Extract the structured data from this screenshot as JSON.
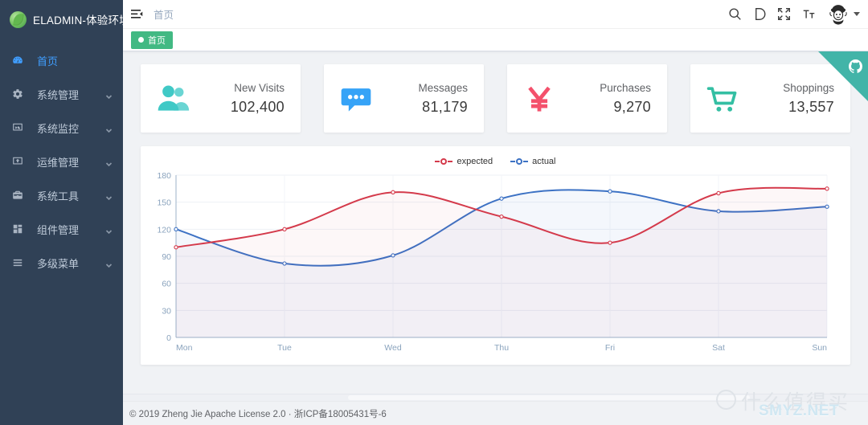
{
  "app": {
    "brand": "ELADMIN-体验环境",
    "logo_icon": "leaf-logo-icon"
  },
  "sidebar": {
    "items": [
      {
        "label": "首页",
        "icon": "dashboard-icon",
        "active": true,
        "expandable": false
      },
      {
        "label": "系统管理",
        "icon": "gear-icon",
        "active": false,
        "expandable": true
      },
      {
        "label": "系统监控",
        "icon": "monitor-icon",
        "active": false,
        "expandable": true
      },
      {
        "label": "运维管理",
        "icon": "deploy-icon",
        "active": false,
        "expandable": true
      },
      {
        "label": "系统工具",
        "icon": "toolbox-icon",
        "active": false,
        "expandable": true
      },
      {
        "label": "组件管理",
        "icon": "components-icon",
        "active": false,
        "expandable": true
      },
      {
        "label": "多级菜单",
        "icon": "menu-list-icon",
        "active": false,
        "expandable": true
      }
    ]
  },
  "navbar": {
    "hamburger_icon": "hamburger-icon",
    "breadcrumb": "首页",
    "icons": [
      {
        "name": "search-icon",
        "glyph": "search"
      },
      {
        "name": "documentation-icon",
        "glyph": "D"
      },
      {
        "name": "fullscreen-icon",
        "glyph": "expand"
      },
      {
        "name": "font-size-icon",
        "glyph": "T"
      }
    ],
    "avatar_icon": "user-avatar",
    "avatar_caret_icon": "chevron-down-icon"
  },
  "tags_view": {
    "tags": [
      {
        "label": "首页",
        "active": true
      }
    ]
  },
  "cards": [
    {
      "title": "New Visits",
      "value": "102,400",
      "icon": "people-icon",
      "color": "#40c9c6"
    },
    {
      "title": "Messages",
      "value": "81,179",
      "icon": "message-icon",
      "color": "#36a3f7"
    },
    {
      "title": "Purchases",
      "value": "9,270",
      "icon": "money-icon",
      "color": "#f4516c"
    },
    {
      "title": "Shoppings",
      "value": "13,557",
      "icon": "shopping-icon",
      "color": "#34bfa3"
    }
  ],
  "chart_data": {
    "type": "line",
    "title": "",
    "xlabel": "",
    "ylabel": "",
    "categories": [
      "Mon",
      "Tue",
      "Wed",
      "Thu",
      "Fri",
      "Sat",
      "Sun"
    ],
    "series": [
      {
        "name": "expected",
        "color": "#d43a4b",
        "values": [
          100,
          120,
          161,
          134,
          105,
          160,
          165
        ]
      },
      {
        "name": "actual",
        "color": "#3d72c4",
        "values": [
          120,
          82,
          91,
          154,
          162,
          140,
          145
        ]
      }
    ],
    "ylim": [
      0,
      180
    ],
    "yticks": [
      0,
      30,
      60,
      90,
      120,
      150,
      180
    ],
    "grid": true,
    "smooth": true,
    "area_fill": true,
    "legend_position": "top-center"
  },
  "ribbon": {
    "icon": "github-icon",
    "color": "#42b4a8"
  },
  "footer": {
    "text": "© 2019 Zheng Jie Apache License 2.0 · 浙ICP备18005431号-6"
  },
  "watermark": {
    "cn_text": "什么值得买",
    "badge_text": "值",
    "site": "SMYZ.NET"
  }
}
